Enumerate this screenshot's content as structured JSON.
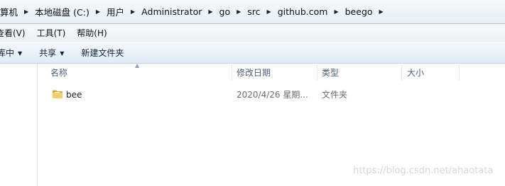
{
  "address": {
    "crumbs": [
      "算机",
      "本地磁盘 (C:)",
      "用户",
      "Administrator",
      "go",
      "src",
      "github.com",
      "beego"
    ]
  },
  "menu": {
    "items": [
      "查看(V)",
      "工具(T)",
      "帮助(H)"
    ]
  },
  "commands": {
    "include_label": "库中",
    "share_label": "共享",
    "newfolder_label": "新建文件夹"
  },
  "columns": {
    "name": "名称",
    "modified": "修改日期",
    "type": "类型",
    "size": "大小"
  },
  "files": [
    {
      "name": "bee",
      "modified": "2020/4/26 星期...",
      "type": "文件夹",
      "size": "",
      "icon": "folder-icon"
    }
  ],
  "watermark": "https://blog.csdn.net/ahaotata",
  "colors": {
    "folder": "#e8c15a",
    "header_text": "#4c607a"
  }
}
